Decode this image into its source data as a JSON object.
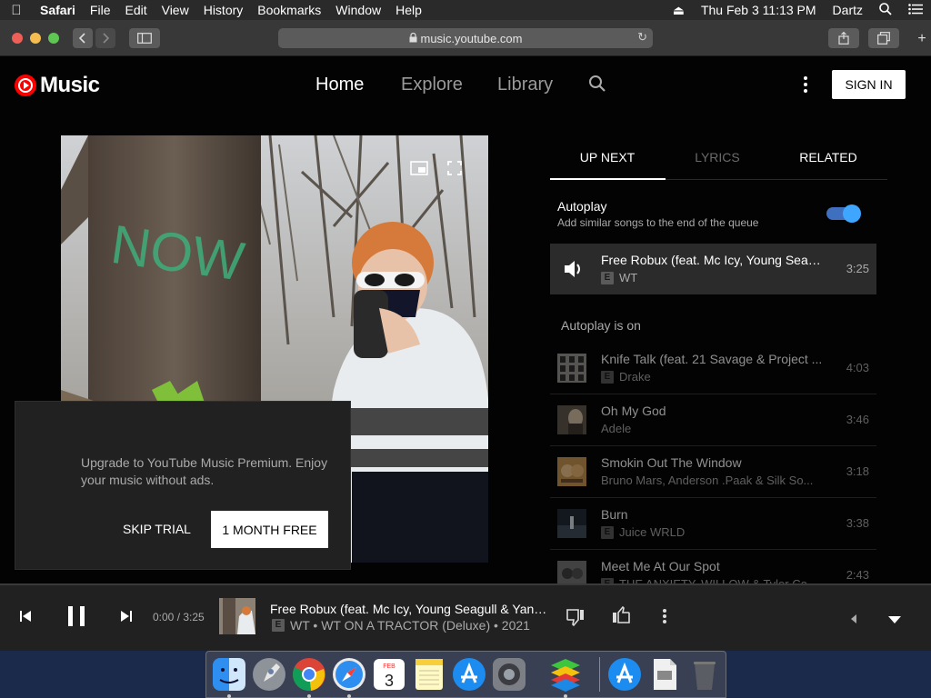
{
  "menubar": {
    "app": "Safari",
    "items": [
      "File",
      "Edit",
      "View",
      "History",
      "Bookmarks",
      "Window",
      "Help"
    ],
    "datetime": "Thu Feb 3  11:13 PM",
    "user": "Dartz"
  },
  "browser": {
    "url": "music.youtube.com"
  },
  "header": {
    "logo_text": "Music",
    "nav": [
      "Home",
      "Explore",
      "Library"
    ],
    "signin_label": "SIGN IN"
  },
  "upgrade": {
    "message": "Upgrade to YouTube Music Premium. Enjoy your music without ads.",
    "skip_label": "SKIP TRIAL",
    "free_label": "1 MONTH FREE"
  },
  "queue": {
    "tabs": [
      "UP NEXT",
      "LYRICS",
      "RELATED"
    ],
    "autoplay_title": "Autoplay",
    "autoplay_sub": "Add similar songs to the end of the queue",
    "autoplay_enabled": true,
    "current": {
      "title": "Free Robux (feat. Mc Icy, Young Seag...",
      "artist": "WT",
      "duration": "3:25",
      "explicit": true
    },
    "autoplay_on_label": "Autoplay is on",
    "badge_letter": "E",
    "items": [
      {
        "title": "Knife Talk (feat. 21 Savage & Project ...",
        "artist": "Drake",
        "duration": "4:03",
        "explicit": true
      },
      {
        "title": "Oh My God",
        "artist": "Adele",
        "duration": "3:46",
        "explicit": false
      },
      {
        "title": "Smokin Out The Window",
        "artist": "Bruno Mars, Anderson .Paak & Silk So...",
        "duration": "3:18",
        "explicit": false
      },
      {
        "title": "Burn",
        "artist": "Juice WRLD",
        "duration": "3:38",
        "explicit": true
      },
      {
        "title": "Meet Me At Our Spot",
        "artist": "THE ANXIETY, WILLOW & Tyler Co...",
        "duration": "2:43",
        "explicit": true
      }
    ]
  },
  "player": {
    "time": "0:00 / 3:25",
    "title": "Free Robux (feat. Mc Icy, Young Seagull & Yang...",
    "subtitle": "WT • WT ON A TRACTOR (Deluxe) • 2021",
    "explicit": true
  },
  "dock": {
    "icons": [
      "finder-icon",
      "launchpad-icon",
      "chrome-icon",
      "safari-icon",
      "calendar-icon",
      "notes-icon",
      "app-store-icon",
      "system-preferences-icon",
      "bluestacks-icon",
      "app-store-folder-icon",
      "downloads-icon",
      "trash-icon"
    ],
    "calendar_month": "FEB",
    "calendar_day": "3"
  },
  "colors": {
    "accent_red": "#ff0000",
    "toggle_blue": "#3ea6ff",
    "background": "#030303"
  }
}
